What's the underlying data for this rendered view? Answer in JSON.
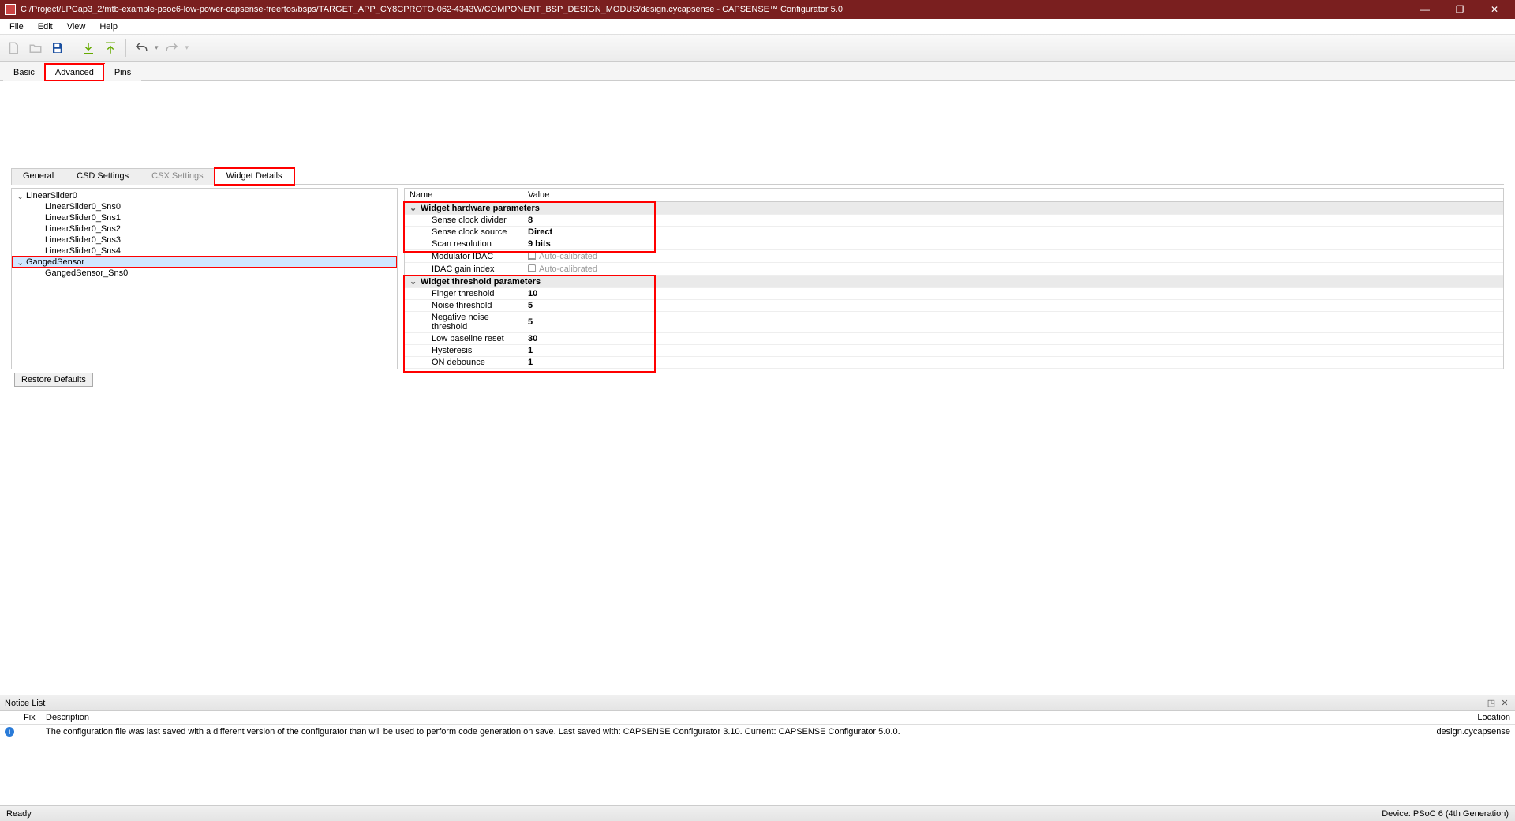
{
  "window": {
    "title": "C:/Project/LPCap3_2/mtb-example-psoc6-low-power-capsense-freertos/bsps/TARGET_APP_CY8CPROTO-062-4343W/COMPONENT_BSP_DESIGN_MODUS/design.cycapsense - CAPSENSE™ Configurator 5.0"
  },
  "menu": {
    "file": "File",
    "edit": "Edit",
    "view": "View",
    "help": "Help"
  },
  "toptabs": {
    "basic": "Basic",
    "advanced": "Advanced",
    "pins": "Pins"
  },
  "subtabs": {
    "general": "General",
    "csd": "CSD Settings",
    "csx": "CSX Settings",
    "widget": "Widget Details"
  },
  "tree": {
    "items": [
      {
        "label": "LinearSlider0",
        "expandable": true
      },
      {
        "label": "LinearSlider0_Sns0",
        "child": true
      },
      {
        "label": "LinearSlider0_Sns1",
        "child": true
      },
      {
        "label": "LinearSlider0_Sns2",
        "child": true
      },
      {
        "label": "LinearSlider0_Sns3",
        "child": true
      },
      {
        "label": "LinearSlider0_Sns4",
        "child": true
      },
      {
        "label": "GangedSensor",
        "expandable": true,
        "selected": true,
        "hl": true
      },
      {
        "label": "GangedSensor_Sns0",
        "child": true
      }
    ],
    "restore": "Restore Defaults"
  },
  "prop": {
    "hdr_name": "Name",
    "hdr_value": "Value",
    "grp_hw": "Widget hardware parameters",
    "hw": [
      {
        "n": "Sense clock divider",
        "v": "8",
        "bold": true
      },
      {
        "n": "Sense clock source",
        "v": "Direct",
        "bold": true
      },
      {
        "n": "Scan resolution",
        "v": "9 bits",
        "bold": true
      },
      {
        "n": "Modulator IDAC",
        "v": "Auto-calibrated",
        "muted": true,
        "lock": true
      },
      {
        "n": "IDAC gain index",
        "v": "Auto-calibrated",
        "muted": true,
        "lock": true
      }
    ],
    "grp_th": "Widget threshold parameters",
    "th": [
      {
        "n": "Finger threshold",
        "v": "10",
        "bold": true
      },
      {
        "n": "Noise threshold",
        "v": "5",
        "bold": true
      },
      {
        "n": "Negative noise threshold",
        "v": "5",
        "bold": true
      },
      {
        "n": "Low baseline reset",
        "v": "30",
        "bold": true
      },
      {
        "n": "Hysteresis",
        "v": "1",
        "bold": true
      },
      {
        "n": "ON debounce",
        "v": "1",
        "bold": true
      }
    ]
  },
  "notice": {
    "title": "Notice List",
    "cols": {
      "fix": "Fix",
      "desc": "Description",
      "loc": "Location"
    },
    "rows": [
      {
        "desc": "The configuration file was last saved with a different version of the configurator than will be used to perform code generation on save. Last saved with: CAPSENSE Configurator 3.10. Current: CAPSENSE Configurator 5.0.0.",
        "loc": "design.cycapsense"
      }
    ]
  },
  "status": {
    "left": "Ready",
    "right": "Device: PSoC 6 (4th Generation)"
  }
}
